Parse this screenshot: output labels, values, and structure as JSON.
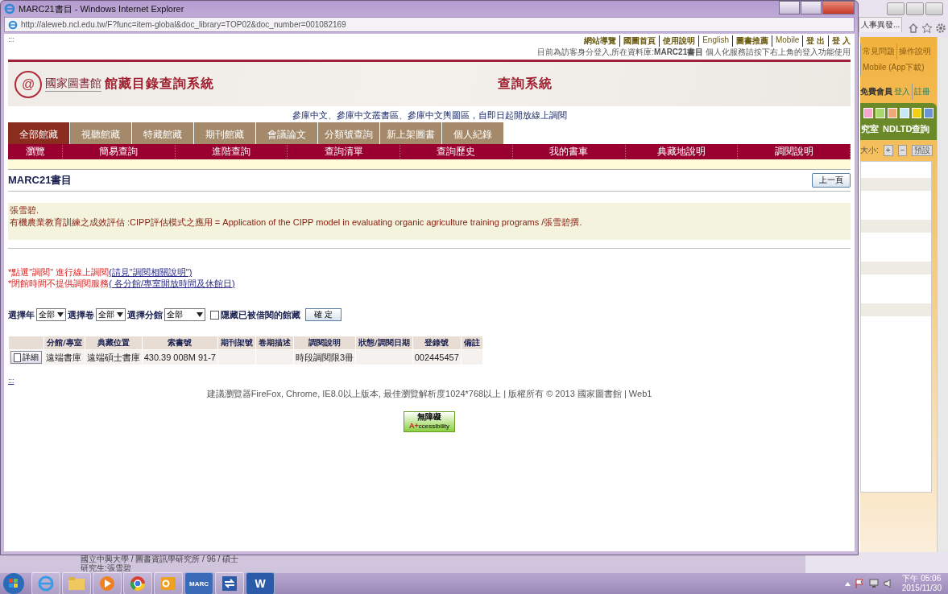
{
  "window": {
    "title": "MARC21書目 - Windows Internet Explorer",
    "address": "http://aleweb.ncl.edu.tw/F?func=item-global&doc_library=TOP02&doc_number=001082169"
  },
  "page": {
    "skip_mark": ":::",
    "top_links": [
      "網站導覽",
      "國圖首頁",
      "使用說明",
      "English",
      "圖書推薦",
      "Mobile",
      "登 出",
      "登 入"
    ],
    "login_status": "目前為訪客身分登入,所在資料庫:**MARC21書目** 個人化服務請按下右上角的登入功能使用",
    "logo_mark": "@",
    "logo_name": "國家圖書館",
    "system_title": "館藏目錄查詢系統",
    "banner_title": "查詢系統",
    "notice": "參庫中文、參庫中文叢書區、參庫中文輿圖區，自即日起開放線上調閱",
    "tabs": [
      {
        "label": "全部館藏",
        "selected": true
      },
      {
        "label": "視聽館藏",
        "selected": false
      },
      {
        "label": "特藏館藏",
        "selected": false
      },
      {
        "label": "期刊館藏",
        "selected": false
      },
      {
        "label": "會議論文",
        "selected": false
      },
      {
        "label": "分類號查詢",
        "selected": false
      },
      {
        "label": "新上架圖書",
        "selected": false
      },
      {
        "label": "個人紀錄",
        "selected": false
      }
    ],
    "menu": [
      "瀏覽",
      "簡易查詢",
      "進階查詢",
      "查詢清單",
      "查詢歷史",
      "我的書車",
      "典藏地說明",
      "調閱說明"
    ],
    "heading": "MARC21書目",
    "back_button": "上一頁",
    "record": [
      "張雪碧.",
      "有機農業教育訓練之成效評估 :CIPP評估模式之應用 = Application of the CIPP model in evaluating organic agriculture training programs /張雪碧撰."
    ],
    "instructions": [
      {
        "text": "*點選\"調閱\" 進行線上調閱",
        "link": "(請見\"調閱相關說明\")"
      },
      {
        "text": "*閉館時間不提供調閱服務",
        "link": "( 各分館/專室開放時間及休館日)"
      }
    ],
    "filters": [
      {
        "label": "選擇年",
        "value": "全部"
      },
      {
        "label": "選擇卷",
        "value": "全部"
      },
      {
        "label": "選擇分館",
        "value": "全部"
      }
    ],
    "hide_loaned": {
      "label": "隱藏已被借閱的館藏",
      "checked": false
    },
    "confirm_button": "確 定",
    "table": {
      "columns": [
        "分館/專室",
        "典藏位置",
        "索書號",
        "期刊架號",
        "卷期描述",
        "調閱說明",
        "狀態/調閱日期",
        "登錄號",
        "備註"
      ],
      "rows": [
        {
          "detail_button": "詳細",
          "cells": [
            "遠端書庫",
            "遠端碩士書庫",
            "430.39 008M 91-7",
            null,
            null,
            "時段調閱限3冊",
            null,
            "002445457",
            null
          ]
        }
      ]
    },
    "bottom_mark": ":::",
    "footer": "建議瀏覽器FireFox, Chrome, IE8.0以上版本, 最佳瀏覽解析度1024*768以上 | 版權所有 © 2013 國家圖書館 | Web1",
    "badge": {
      "title": "無障礙",
      "prefix": "A+",
      "suffix": "ccessibility"
    }
  },
  "background_window": {
    "tab": "人事異發...",
    "links": [
      "常見問題",
      "操作說明"
    ],
    "mobile": "Mobile (App下載)",
    "member": "免費會員",
    "login": "登入",
    "register": "註冊",
    "swatches": [
      {
        "color": "#f4a6cc"
      },
      {
        "color": "#a6d86c"
      },
      {
        "color": "#f0a878"
      },
      {
        "color": "#c8e8f8"
      },
      {
        "color": "#f0d010"
      },
      {
        "color": "#6a94d4"
      }
    ],
    "nav": [
      "究室",
      "NDLTD查詢"
    ],
    "font_size_label": "大小:",
    "font_buttons": [
      "+",
      "−",
      "預設"
    ],
    "bottom_lines": [
      "國立中興大學 / 圖書資訊學研究所 / 96 / 碩士",
      "研究生:張雪碧"
    ]
  },
  "taskbar": {
    "marc_label": "MARC",
    "word_label": "W",
    "time": "下午 05:06",
    "date": "2015/11/30"
  }
}
